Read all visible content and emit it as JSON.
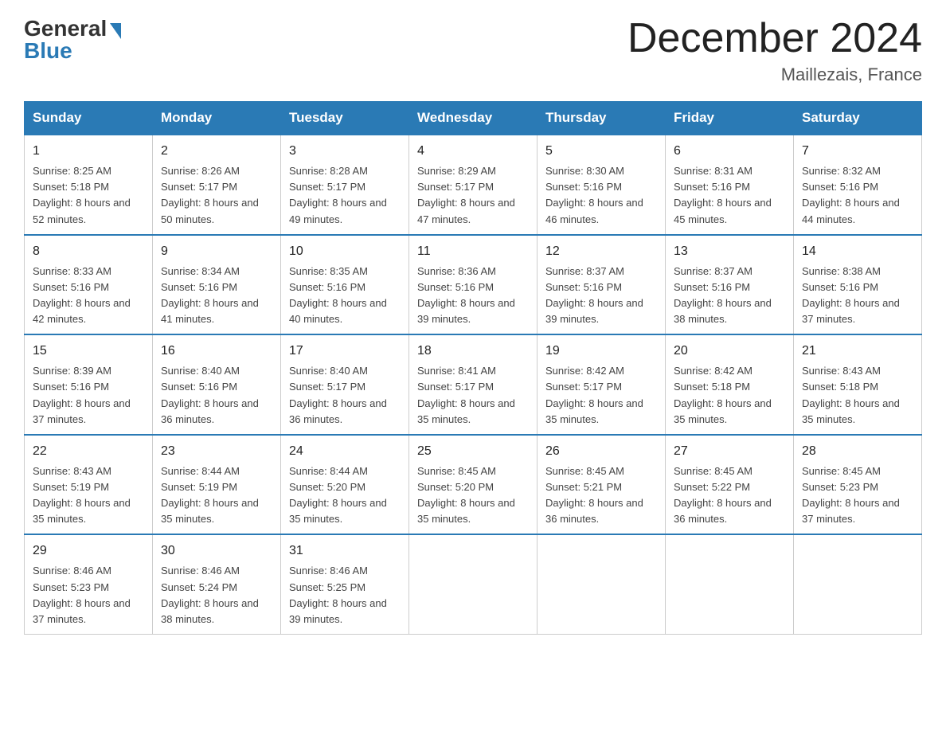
{
  "header": {
    "logo_general": "General",
    "logo_blue": "Blue",
    "month_title": "December 2024",
    "location": "Maillezais, France"
  },
  "days_of_week": [
    "Sunday",
    "Monday",
    "Tuesday",
    "Wednesday",
    "Thursday",
    "Friday",
    "Saturday"
  ],
  "weeks": [
    [
      {
        "day": "1",
        "sunrise": "8:25 AM",
        "sunset": "5:18 PM",
        "daylight": "8 hours and 52 minutes."
      },
      {
        "day": "2",
        "sunrise": "8:26 AM",
        "sunset": "5:17 PM",
        "daylight": "8 hours and 50 minutes."
      },
      {
        "day": "3",
        "sunrise": "8:28 AM",
        "sunset": "5:17 PM",
        "daylight": "8 hours and 49 minutes."
      },
      {
        "day": "4",
        "sunrise": "8:29 AM",
        "sunset": "5:17 PM",
        "daylight": "8 hours and 47 minutes."
      },
      {
        "day": "5",
        "sunrise": "8:30 AM",
        "sunset": "5:16 PM",
        "daylight": "8 hours and 46 minutes."
      },
      {
        "day": "6",
        "sunrise": "8:31 AM",
        "sunset": "5:16 PM",
        "daylight": "8 hours and 45 minutes."
      },
      {
        "day": "7",
        "sunrise": "8:32 AM",
        "sunset": "5:16 PM",
        "daylight": "8 hours and 44 minutes."
      }
    ],
    [
      {
        "day": "8",
        "sunrise": "8:33 AM",
        "sunset": "5:16 PM",
        "daylight": "8 hours and 42 minutes."
      },
      {
        "day": "9",
        "sunrise": "8:34 AM",
        "sunset": "5:16 PM",
        "daylight": "8 hours and 41 minutes."
      },
      {
        "day": "10",
        "sunrise": "8:35 AM",
        "sunset": "5:16 PM",
        "daylight": "8 hours and 40 minutes."
      },
      {
        "day": "11",
        "sunrise": "8:36 AM",
        "sunset": "5:16 PM",
        "daylight": "8 hours and 39 minutes."
      },
      {
        "day": "12",
        "sunrise": "8:37 AM",
        "sunset": "5:16 PM",
        "daylight": "8 hours and 39 minutes."
      },
      {
        "day": "13",
        "sunrise": "8:37 AM",
        "sunset": "5:16 PM",
        "daylight": "8 hours and 38 minutes."
      },
      {
        "day": "14",
        "sunrise": "8:38 AM",
        "sunset": "5:16 PM",
        "daylight": "8 hours and 37 minutes."
      }
    ],
    [
      {
        "day": "15",
        "sunrise": "8:39 AM",
        "sunset": "5:16 PM",
        "daylight": "8 hours and 37 minutes."
      },
      {
        "day": "16",
        "sunrise": "8:40 AM",
        "sunset": "5:16 PM",
        "daylight": "8 hours and 36 minutes."
      },
      {
        "day": "17",
        "sunrise": "8:40 AM",
        "sunset": "5:17 PM",
        "daylight": "8 hours and 36 minutes."
      },
      {
        "day": "18",
        "sunrise": "8:41 AM",
        "sunset": "5:17 PM",
        "daylight": "8 hours and 35 minutes."
      },
      {
        "day": "19",
        "sunrise": "8:42 AM",
        "sunset": "5:17 PM",
        "daylight": "8 hours and 35 minutes."
      },
      {
        "day": "20",
        "sunrise": "8:42 AM",
        "sunset": "5:18 PM",
        "daylight": "8 hours and 35 minutes."
      },
      {
        "day": "21",
        "sunrise": "8:43 AM",
        "sunset": "5:18 PM",
        "daylight": "8 hours and 35 minutes."
      }
    ],
    [
      {
        "day": "22",
        "sunrise": "8:43 AM",
        "sunset": "5:19 PM",
        "daylight": "8 hours and 35 minutes."
      },
      {
        "day": "23",
        "sunrise": "8:44 AM",
        "sunset": "5:19 PM",
        "daylight": "8 hours and 35 minutes."
      },
      {
        "day": "24",
        "sunrise": "8:44 AM",
        "sunset": "5:20 PM",
        "daylight": "8 hours and 35 minutes."
      },
      {
        "day": "25",
        "sunrise": "8:45 AM",
        "sunset": "5:20 PM",
        "daylight": "8 hours and 35 minutes."
      },
      {
        "day": "26",
        "sunrise": "8:45 AM",
        "sunset": "5:21 PM",
        "daylight": "8 hours and 36 minutes."
      },
      {
        "day": "27",
        "sunrise": "8:45 AM",
        "sunset": "5:22 PM",
        "daylight": "8 hours and 36 minutes."
      },
      {
        "day": "28",
        "sunrise": "8:45 AM",
        "sunset": "5:23 PM",
        "daylight": "8 hours and 37 minutes."
      }
    ],
    [
      {
        "day": "29",
        "sunrise": "8:46 AM",
        "sunset": "5:23 PM",
        "daylight": "8 hours and 37 minutes."
      },
      {
        "day": "30",
        "sunrise": "8:46 AM",
        "sunset": "5:24 PM",
        "daylight": "8 hours and 38 minutes."
      },
      {
        "day": "31",
        "sunrise": "8:46 AM",
        "sunset": "5:25 PM",
        "daylight": "8 hours and 39 minutes."
      },
      null,
      null,
      null,
      null
    ]
  ]
}
